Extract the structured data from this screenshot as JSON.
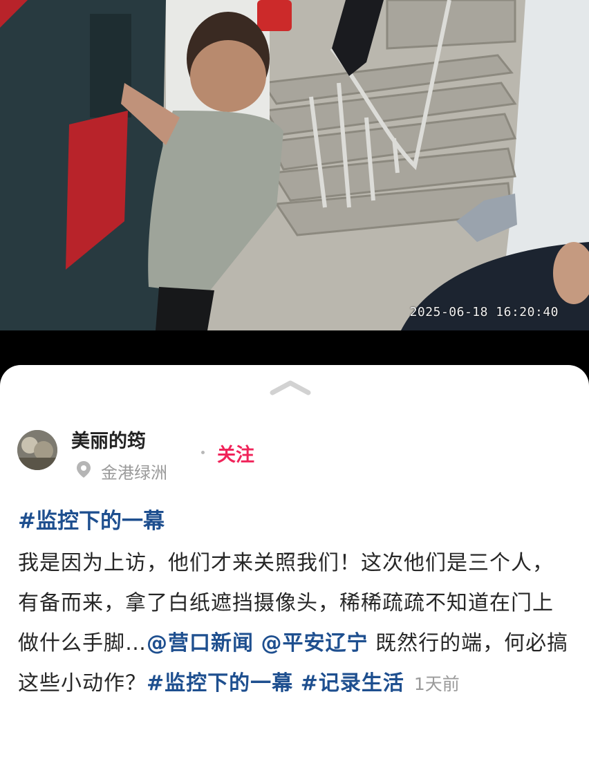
{
  "video": {
    "timestamp": "2025-06-18 16:20:40"
  },
  "post": {
    "author": "美丽的筠",
    "location": "金港绿洲",
    "follow_label": "关注",
    "title_tag": "#监控下的一幕",
    "body_text_1": "我是因为上访，他们才来关照我们！这次他们是三个人，有备而来，拿了白纸遮挡摄像头，稀稀疏疏不知道在门上做什么手脚…",
    "mention_1": "@营口新闻",
    "mention_2": "@平安辽宁",
    "body_text_2": " 既然行的端，何必搞这些小动作？",
    "tag_1": "#监控下的一幕",
    "tag_2": "#记录生活",
    "time_ago": "1天前"
  },
  "colors": {
    "accent_follow": "#f0245a",
    "link_blue": "#1e4f8f",
    "muted_gray": "#9a9a9a"
  },
  "icons": [
    "chevron-up-icon",
    "location-pin-icon"
  ]
}
